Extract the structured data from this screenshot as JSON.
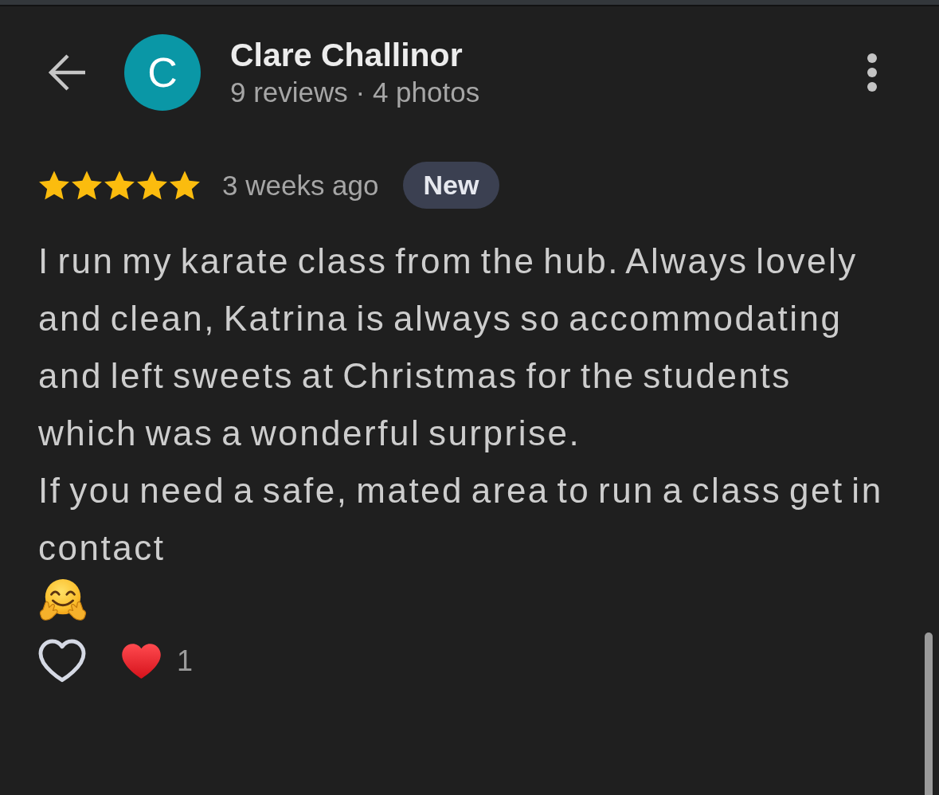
{
  "header": {
    "avatar_letter": "C",
    "name": "Clare Challinor",
    "stats": "9 reviews · 4 photos"
  },
  "review": {
    "stars": 5,
    "time": "3 weeks ago",
    "badge": "New",
    "text": "I run my karate class from the hub. Always lovely and clean, Katrina is always so accommodating and left sweets at Christmas for the students which was a wonderful surprise.\nIf you need a safe, mated area to run a class get in contact"
  },
  "reactions": {
    "liked": false,
    "count": "1"
  }
}
